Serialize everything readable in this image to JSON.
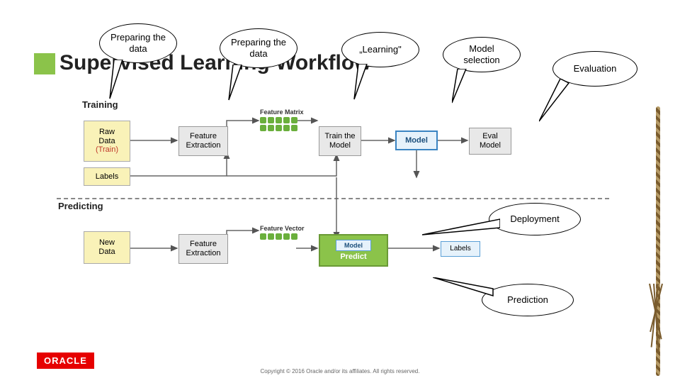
{
  "title": "Supervised Learning Workflow",
  "sections": {
    "training": "Training",
    "predicting": "Predicting"
  },
  "bubbles": {
    "prep1": "Preparing the data",
    "prep2": "Preparing the data",
    "learning": "„Learning\"",
    "modelsel": "Model selection",
    "evaluation": "Evaluation",
    "deployment": "Deployment",
    "prediction": "Prediction"
  },
  "boxes": {
    "raw_train_l1": "Raw",
    "raw_train_l2": "Data",
    "raw_train_l3": "(Train)",
    "labels_top": "Labels",
    "feat1": "Feature Extraction",
    "feat_matrix": "Feature Matrix",
    "train_model": "Train the Model",
    "model": "Model",
    "eval": "Eval Model",
    "new_data_l1": "New",
    "new_data_l2": "Data",
    "feat2": "Feature Extraction",
    "feat_vector": "Feature Vector",
    "model_small": "Model",
    "predict": "Predict",
    "labels_out": "Labels"
  },
  "footer": {
    "logo": "ORACLE",
    "copyright": "Copyright © 2016 Oracle and/or its affiliates. All rights reserved."
  }
}
